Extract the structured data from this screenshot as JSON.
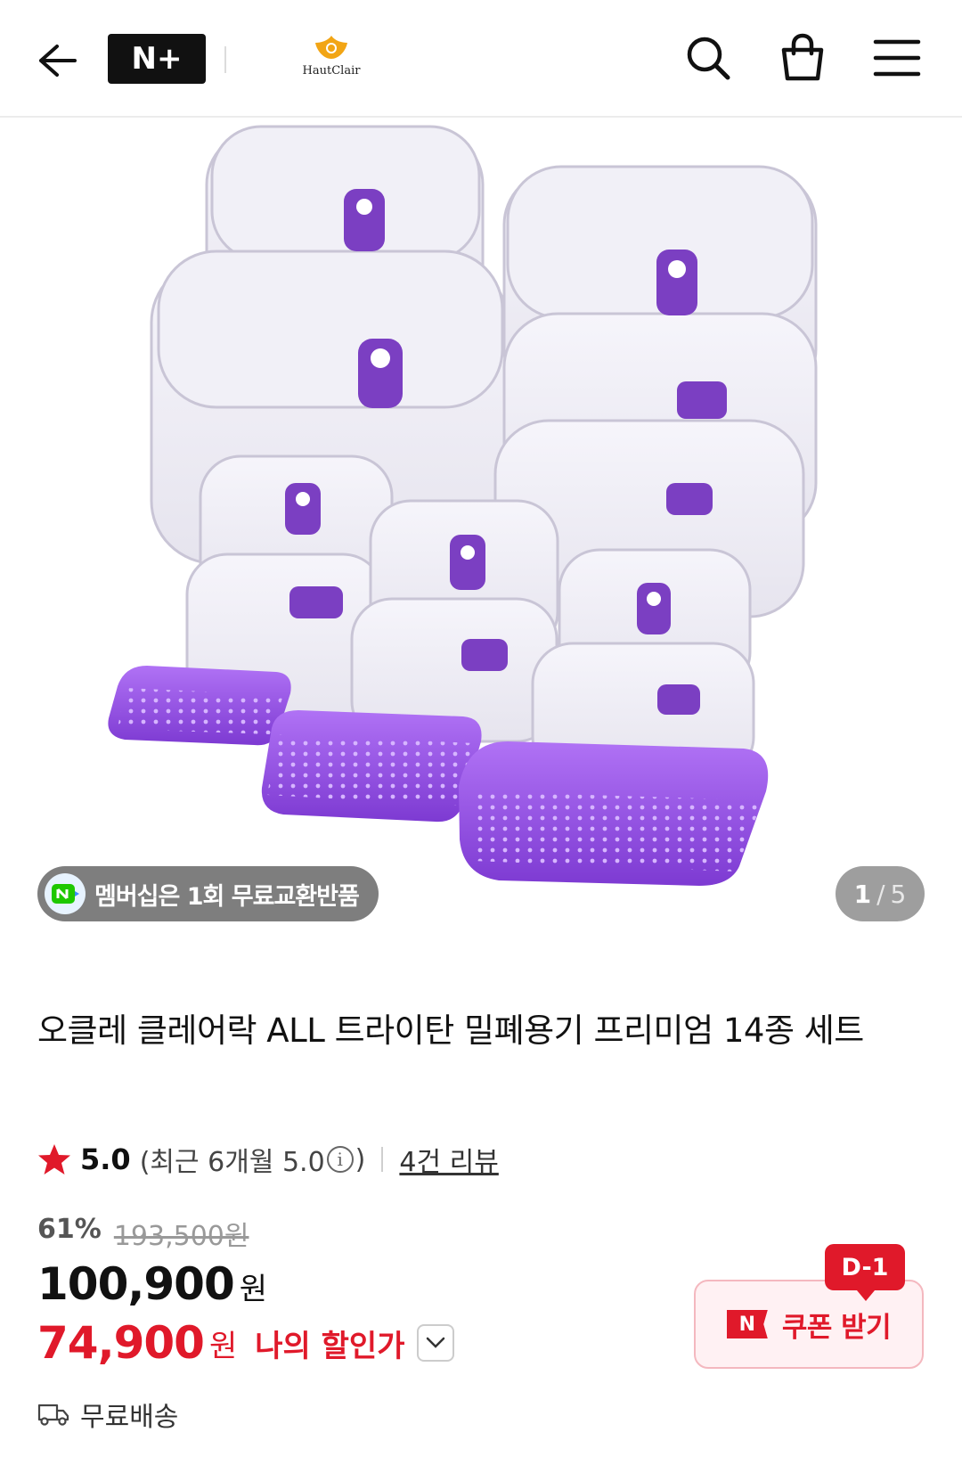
{
  "header": {
    "back_icon": "arrow-left-icon",
    "nplus_badge": "N+",
    "brand_name": "HautClair",
    "icons": [
      "search-icon",
      "shopping-bag-icon",
      "hamburger-menu-icon"
    ]
  },
  "gallery": {
    "membership_badge": "멤버십은 1회 무료교환반품",
    "current_index": "1",
    "separator": "/",
    "total": "5"
  },
  "product": {
    "title": "오클레 클레어락 ALL 트라이탄 밀폐용기 프리미엄 14종 세트"
  },
  "rating": {
    "score": "5.0",
    "recent_prefix": "(최근 6개월 5.0",
    "recent_suffix": ")",
    "info_icon": "i",
    "review_count": "4건 리뷰"
  },
  "price": {
    "discount_percent": "61%",
    "original_price": "193,500원",
    "sale_price": "100,900",
    "sale_unit": "원",
    "my_price": "74,900",
    "my_unit": "원",
    "my_price_label": "나의 할인가"
  },
  "coupon": {
    "dday": "D-1",
    "n_label": "N",
    "label": "쿠폰 받기"
  },
  "shipping": {
    "label": "무료배송"
  },
  "colors": {
    "accent_red": "#e0192a",
    "lid_purple": "#7b3fc2",
    "tray_purple": "#9a55e6"
  }
}
